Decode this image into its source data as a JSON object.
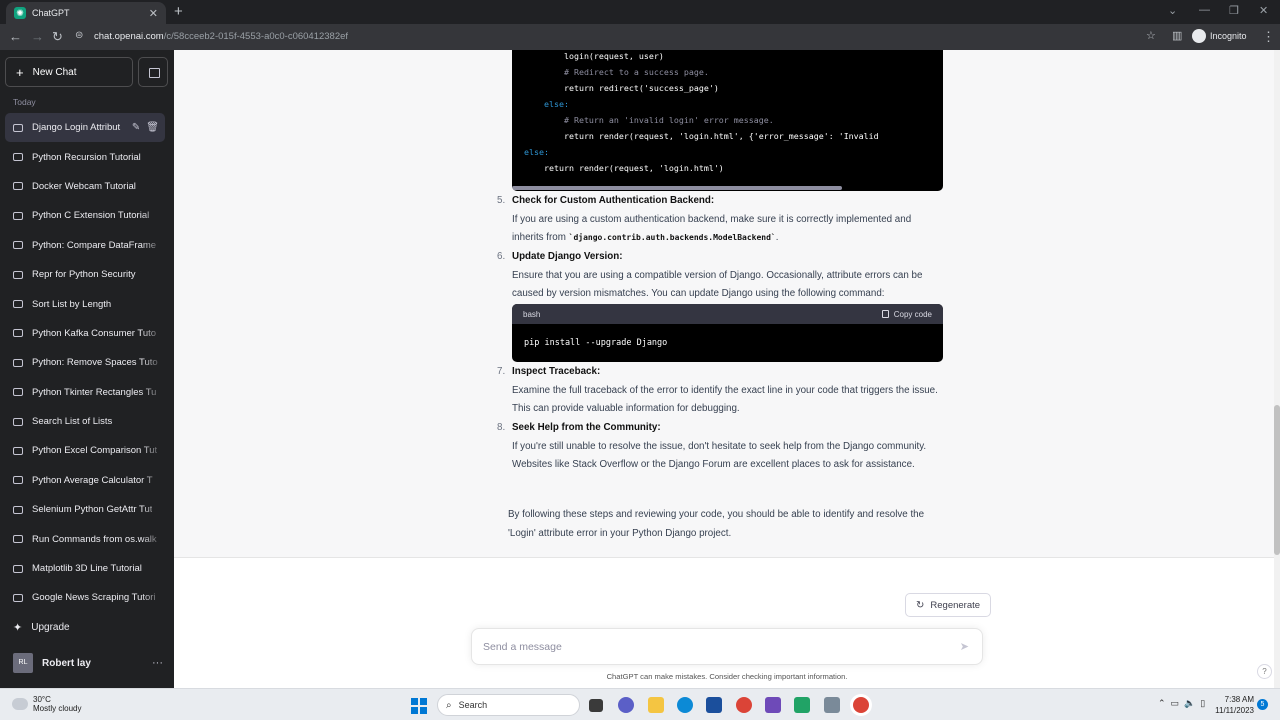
{
  "browser": {
    "tab_title": "ChatGPT",
    "url_host": "chat.openai.com",
    "url_path": "/c/58cceeb2-015f-4553-a0c0-c060412382ef",
    "mode_label": "Incognito"
  },
  "sidebar": {
    "new_chat_label": "New Chat",
    "group_label": "Today",
    "items": [
      {
        "label": "Django Login Attribut"
      },
      {
        "label": "Python Recursion Tutorial"
      },
      {
        "label": "Docker Webcam Tutorial"
      },
      {
        "label": "Python C Extension Tutorial"
      },
      {
        "label": "Python: Compare DataFrame"
      },
      {
        "label": "Repr for Python Security"
      },
      {
        "label": "Sort List by Length"
      },
      {
        "label": "Python Kafka Consumer Tuto"
      },
      {
        "label": "Python: Remove Spaces Tuto"
      },
      {
        "label": "Python Tkinter Rectangles Tu"
      },
      {
        "label": "Search List of Lists"
      },
      {
        "label": "Python Excel Comparison Tut"
      },
      {
        "label": "Python Average Calculator T"
      },
      {
        "label": "Selenium Python GetAttr Tut"
      },
      {
        "label": "Run Commands from os.walk"
      },
      {
        "label": "Matplotlib 3D Line Tutorial"
      },
      {
        "label": "Google News Scraping Tutori"
      }
    ],
    "upgrade_label": "Upgrade",
    "user_initials": "RL",
    "user_name": "Robert lay"
  },
  "conversation": {
    "code_top_lines": [
      "        login(request, user)",
      "        # Redirect to a success page.",
      "        return redirect('success_page')",
      "    else:",
      "        # Return an 'invalid login' error message.",
      "        return render(request, 'login.html', {'error_message': 'Invalid",
      "else:",
      "    return render(request, 'login.html')"
    ],
    "steps": [
      {
        "num": "5.",
        "title": "Check for Custom Authentication Backend:",
        "text_a": "If you are using a custom authentication backend, make sure it is correctly implemented and inherits from ",
        "code": "`django.contrib.auth.backends.ModelBackend`",
        "text_b": "."
      },
      {
        "num": "6.",
        "title": "Update Django Version:",
        "text": "Ensure that you are using a compatible version of Django. Occasionally, attribute errors can be caused by version mismatches. You can update Django using the following command:"
      },
      {
        "num": "7.",
        "title": "Inspect Traceback:",
        "text": "Examine the full traceback of the error to identify the exact line in your code that triggers the issue. This can provide valuable information for debugging."
      },
      {
        "num": "8.",
        "title": "Seek Help from the Community:",
        "text": "If you're still unable to resolve the issue, don't hesitate to seek help from the Django community. Websites like Stack Overflow or the Django Forum are excellent places to ask for assistance."
      }
    ],
    "bash_block": {
      "lang": "bash",
      "copy_label": "Copy code",
      "code": "pip install --upgrade Django"
    },
    "closing": "By following these steps and reviewing your code, you should be able to identify and resolve the 'Login' attribute error in your Python Django project."
  },
  "composer": {
    "regenerate_label": "Regenerate",
    "placeholder": "Send a message",
    "disclaimer": "ChatGPT can make mistakes. Consider checking important information.",
    "help_label": "?"
  },
  "taskbar": {
    "temperature": "30°C",
    "weather": "Mostly cloudy",
    "search_label": "Search",
    "time": "7:38 AM",
    "date": "11/11/2023",
    "notification_count": "5"
  },
  "colors": {
    "sidebar_bg": "#202123",
    "code_bg": "#000000",
    "accent": "#10a37f"
  }
}
